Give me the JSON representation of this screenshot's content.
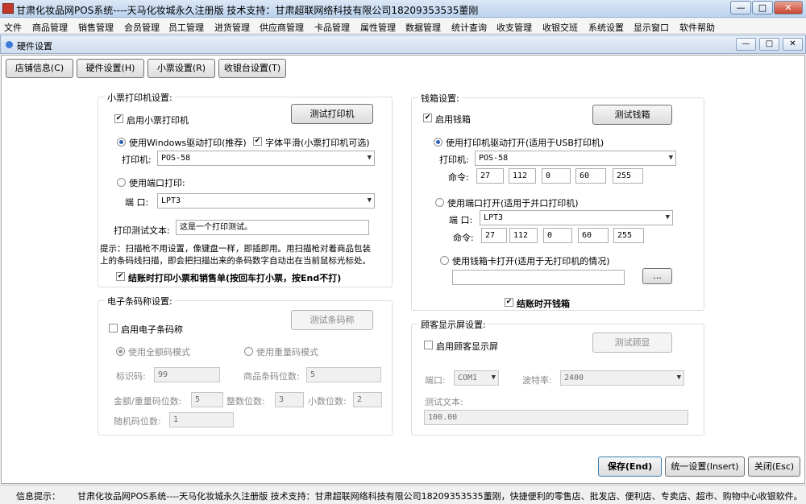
{
  "window": {
    "title": "甘肃化妆品网POS系统----天马化妆城永久注册版   技术支持：甘肃超联网络科技有限公司18209353535董刚",
    "controls": {
      "minimize": "—",
      "maximize": "□",
      "close": "✕"
    }
  },
  "menu": [
    "文件",
    "商品管理",
    "销售管理",
    "会员管理",
    "员工管理",
    "进货管理",
    "供应商管理",
    "卡品管理",
    "属性管理",
    "数据管理",
    "统计查询",
    "收支管理",
    "收银交班",
    "系统设置",
    "显示窗口",
    "软件帮助"
  ],
  "child_window": {
    "title": "硬件设置",
    "controls": {
      "minimize": "—",
      "maximize": "□",
      "close": "✕"
    }
  },
  "tabs": [
    "店铺信息(C)",
    "硬件设置(H)",
    "小票设置(R)",
    "收银台设置(T)"
  ],
  "receipt": {
    "group_title": "小票打印机设置:",
    "test_button": "测试打印机",
    "enable_label": "启用小票打印机",
    "enable_checked": true,
    "driver_radio": "使用Windows驱动打印(推荐)",
    "driver_selected": true,
    "smooth_label": "字体平滑(小票打印机可选)",
    "smooth_checked": true,
    "printer_label": "打印机:",
    "printer_value": "POS-58",
    "port_radio": "使用端口打印:",
    "port_selected": false,
    "port_label": "端 口:",
    "port_value": "LPT3",
    "test_text_label": "打印测试文本:",
    "test_text_value": "这是一个打印测试。",
    "tip_line1": "提示：扫描枪不用设置，像键盘一样，即插即用。用扫描枪对着商品包装",
    "tip_line2": "上的条码线扫描，即会把扫描出来的条码数字自动出在当前鼠标光标处。",
    "print_on_checkout_label": "结账时打印小票和销售单(按回车打小票，按End不打)",
    "print_on_checkout_checked": true
  },
  "barcode": {
    "group_title": "电子条码称设置:",
    "test_button": "测试条码称",
    "enable_label": "启用电子条码称",
    "enable_checked": false,
    "amount_radio": "使用全额码模式",
    "amount_selected": true,
    "weight_radio": "使用重量码模式",
    "weight_selected": false,
    "id_label": "标识码:",
    "id_value": "99",
    "product_digits_label": "商品条码位数:",
    "product_digits_value": "5",
    "amount_digits_label": "金额/重量码位数:",
    "amount_digits_value": "5",
    "int_digits_label": "整数位数:",
    "int_digits_value": "3",
    "dec_digits_label": "小数位数:",
    "dec_digits_value": "2",
    "random_digits_label": "随机码位数:",
    "random_digits_value": "1"
  },
  "drawer": {
    "group_title": "钱箱设置:",
    "test_button": "测试钱箱",
    "enable_label": "启用钱箱",
    "enable_checked": true,
    "driver_radio": "使用打印机驱动打开(适用于USB打印机)",
    "driver_selected": true,
    "printer_label": "打印机:",
    "printer_value": "POS-58",
    "cmd_label": "命令:",
    "cmd_values": [
      "27",
      "112",
      "0",
      "60",
      "255"
    ],
    "port_radio": "使用端口打开(适用于并口打印机)",
    "port_selected": false,
    "port_label": "端 口:",
    "port_value": "LPT3",
    "cmd2_label": "命令:",
    "cmd2_values": [
      "27",
      "112",
      "0",
      "60",
      "255"
    ],
    "card_radio": "使用钱箱卡打开(适用于无打印机的情况)",
    "card_selected": false,
    "card_value": "",
    "browse_button": "...",
    "open_on_checkout_label": "结账时开钱箱",
    "open_on_checkout_checked": true
  },
  "display": {
    "group_title": "顾客显示屏设置:",
    "test_button": "测试顾显",
    "enable_label": "启用顾客显示屏",
    "enable_checked": false,
    "port_label": "端口:",
    "port_value": "COM1",
    "baud_label": "波特率:",
    "baud_value": "2400",
    "test_text_label": "测试文本:",
    "test_text_value": "100.00"
  },
  "footer_buttons": {
    "save": "保存(End)",
    "default": "统一设置(Insert)",
    "close": "关闭(Esc)"
  },
  "status": {
    "label": "信息提示：",
    "text": "甘肃化妆品网POS系统----天马化妆城永久注册版   技术支持：甘肃超联网络科技有限公司18209353535董刚，快捷便利的零售店、批发店、便利店、专卖店、超市、购物中心收银软件。"
  }
}
